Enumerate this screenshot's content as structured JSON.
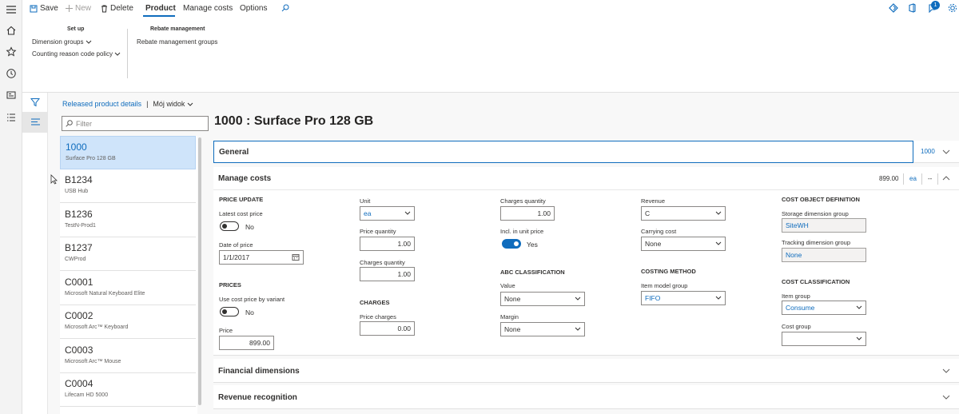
{
  "actionbar": {
    "save": "Save",
    "new": "New",
    "delete": "Delete",
    "tabs": [
      "Product",
      "Manage costs",
      "Options"
    ],
    "notification_count": "1"
  },
  "ribbon": {
    "setup_title": "Set up",
    "dimension_groups": "Dimension groups",
    "counting_reason": "Counting reason code policy",
    "rebate_title": "Rebate management",
    "rebate_groups": "Rebate management groups"
  },
  "breadcrumb": {
    "link": "Released product details",
    "separator": "|",
    "view": "Mój widok"
  },
  "filter": {
    "placeholder": "Filter"
  },
  "page_title": "1000 : Surface Pro 128 GB",
  "products": [
    {
      "code": "1000",
      "name": "Surface Pro 128 GB"
    },
    {
      "code": "B1234",
      "name": "USB Hub"
    },
    {
      "code": "B1236",
      "name": "TestN-Prod1"
    },
    {
      "code": "B1237",
      "name": "CWProd"
    },
    {
      "code": "C0001",
      "name": "Microsoft Natural Keyboard Elite"
    },
    {
      "code": "C0002",
      "name": "Microsoft Arc™ Keyboard"
    },
    {
      "code": "C0003",
      "name": "Microsoft Arc™ Mouse"
    },
    {
      "code": "C0004",
      "name": "Lifecam HD 5000"
    }
  ],
  "general": {
    "title": "General",
    "summary": "1000"
  },
  "manage_costs": {
    "title": "Manage costs",
    "summary_price": "899.00",
    "summary_unit": "ea",
    "summary_more": "--",
    "price_update": {
      "title": "PRICE UPDATE",
      "latest_cost_price_label": "Latest cost price",
      "latest_cost_price_value": "No",
      "date_of_price_label": "Date of price",
      "date_of_price_value": "1/1/2017"
    },
    "prices": {
      "title": "PRICES",
      "use_cost_price_label": "Use cost price by variant",
      "use_cost_price_value": "No",
      "price_label": "Price",
      "price_value": "899.00"
    },
    "col2": {
      "unit_label": "Unit",
      "unit_value": "ea",
      "price_qty_label": "Price quantity",
      "price_qty_value": "1.00",
      "charges_qty_label": "Charges quantity",
      "charges_qty_value": "1.00",
      "charges_title": "CHARGES",
      "price_charges_label": "Price charges",
      "price_charges_value": "0.00"
    },
    "col3": {
      "charges_qty_label": "Charges quantity",
      "charges_qty_value": "1.00",
      "incl_label": "Incl. in unit price",
      "incl_value": "Yes",
      "abc_title": "ABC CLASSIFICATION",
      "value_label": "Value",
      "value_value": "None",
      "margin_label": "Margin",
      "margin_value": "None"
    },
    "col4": {
      "revenue_label": "Revenue",
      "revenue_value": "C",
      "carrying_label": "Carrying cost",
      "carrying_value": "None",
      "costing_title": "COSTING METHOD",
      "item_model_label": "Item model group",
      "item_model_value": "FIFO"
    },
    "col5": {
      "cost_object_title": "COST OBJECT DEFINITION",
      "storage_label": "Storage dimension group",
      "storage_value": "SiteWH",
      "tracking_label": "Tracking dimension group",
      "tracking_value": "None",
      "cost_class_title": "COST CLASSIFICATION",
      "item_group_label": "Item group",
      "item_group_value": "Consume",
      "cost_group_label": "Cost group",
      "cost_group_value": ""
    }
  },
  "financial_dimensions": {
    "title": "Financial dimensions"
  },
  "revenue_recognition": {
    "title": "Revenue recognition"
  },
  "colors": {
    "accent": "#0f6cbd",
    "selected_row": "#cfe4fa"
  }
}
